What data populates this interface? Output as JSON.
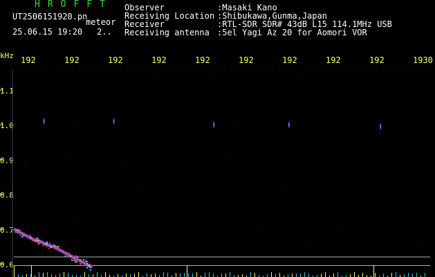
{
  "header": {
    "brand": "HROFFT",
    "file_name": "UT2506151920.pn",
    "file_type": "meteor",
    "timestamp": "25.06.15 19:20",
    "count": "2.."
  },
  "metadata": [
    {
      "key": "Observer",
      "value": ":Masaki Kano"
    },
    {
      "key": "Receiving Location",
      "value": ":Shibukawa,Gunma,Japan"
    },
    {
      "key": "Receiver",
      "value": ":RTL-SDR SDR# 43dB L15 114.1MHz USB"
    },
    {
      "key": "Receiving antenna",
      "value": ":5el Yagi Az 20 for Aomori VOR"
    }
  ],
  "colors": {
    "background": "#000000",
    "text": "#ffffff",
    "axis": "#ffff66",
    "brand": "#33dd33",
    "ref_line": "#b4b4b4"
  },
  "chart_data": {
    "type": "heatmap",
    "ylabel": "kHz",
    "y_ticks": [
      "1.1",
      "1.0",
      "0.9",
      "0.8",
      "0.7",
      "0.6"
    ],
    "x_ticks": [
      "192",
      "192",
      "192",
      "192",
      "192",
      "192",
      "192",
      "192",
      "192",
      "1930"
    ],
    "ylim": [
      0.58,
      1.15
    ],
    "reference_lines_khz": [
      0.62,
      0.595
    ],
    "trace": {
      "x_minutes": [
        0,
        1,
        2,
        3,
        4,
        5,
        6,
        7,
        8,
        9,
        10,
        11,
        12
      ],
      "y_khz": [
        0.7,
        0.69,
        0.68,
        0.67,
        0.665,
        0.655,
        0.65,
        0.64,
        0.63,
        0.62,
        0.61,
        0.6,
        0.59
      ]
    },
    "echo_points": [
      {
        "x_minute": 4.5,
        "y_khz": 1.01
      },
      {
        "x_minute": 15.2,
        "y_khz": 1.01
      },
      {
        "x_minute": 30.5,
        "y_khz": 1.0
      },
      {
        "x_minute": 42,
        "y_khz": 1.0
      },
      {
        "x_minute": 56,
        "y_khz": 0.995
      }
    ]
  }
}
